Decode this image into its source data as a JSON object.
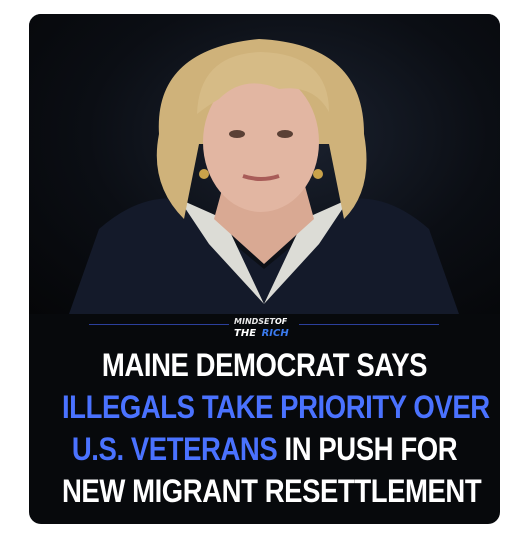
{
  "brand": {
    "line1a": "MINDSET",
    "line1b": "OF",
    "line2a": "THE",
    "line2b": "RICH"
  },
  "headline": {
    "line1": "MAINE DEMOCRAT SAYS",
    "line2": "ILLEGALS TAKE PRIORITY OVER",
    "line3_highlight": "U.S. VETERANS",
    "line3_rest": " IN PUSH FOR",
    "line4": "NEW MIGRANT RESETTLEMENT"
  },
  "colors": {
    "highlight": "#4a72ff",
    "text": "#ffffff",
    "background": "#07090c"
  }
}
